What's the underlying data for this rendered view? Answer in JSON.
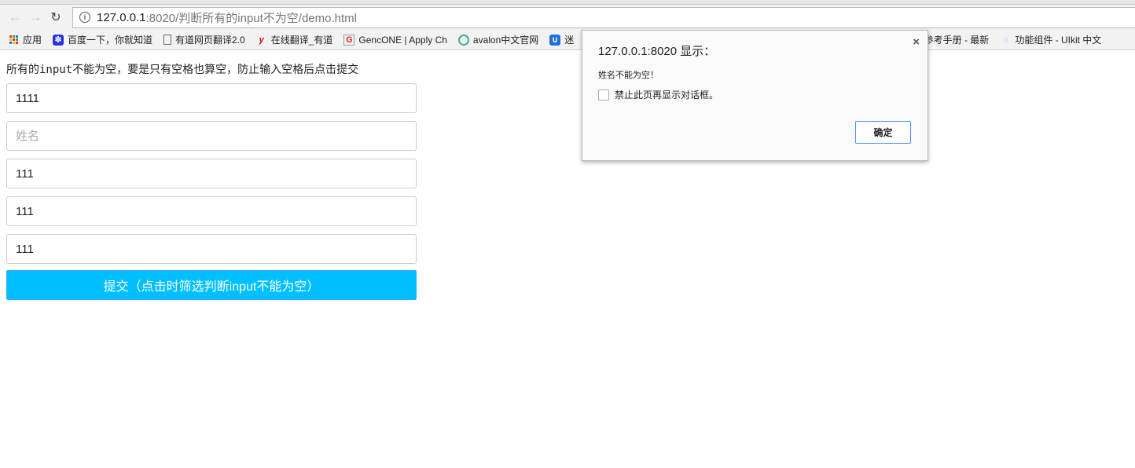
{
  "browser": {
    "url_host": "127.0.0.1",
    "url_path": ":8020/判断所有的input不为空/demo.html"
  },
  "bookmarks": [
    {
      "label": "应用",
      "icon": "apps-grid-icon"
    },
    {
      "label": "百度一下，你就知道",
      "icon": "baidu-paw-icon",
      "color": "#2932e1"
    },
    {
      "label": "有道网页翻译2.0",
      "icon": "page-icon"
    },
    {
      "label": "在线翻译_有道",
      "icon": "youdao-y-icon",
      "color": "#e60012"
    },
    {
      "label": "GencONE | Apply Ch",
      "icon": "g-logo-icon",
      "color": "#d22"
    },
    {
      "label": "avalon中文官网",
      "icon": "avalon-icon",
      "color": "#4a9"
    },
    {
      "label": "迷",
      "icon": "blue-logo-icon",
      "color": "#1e6fd9"
    },
    {
      "label": "CSS3参考手册 - 最新",
      "icon": ""
    },
    {
      "label": "功能组件 - UIkit 中文",
      "icon": "uikit-icon",
      "color": "#39f"
    }
  ],
  "page": {
    "heading": "所有的input不能为空，要是只有空格也算空，防止输入空格后点击提交",
    "inputs": [
      {
        "value": "1111",
        "placeholder": ""
      },
      {
        "value": "",
        "placeholder": "姓名"
      },
      {
        "value": "111",
        "placeholder": ""
      },
      {
        "value": "111",
        "placeholder": ""
      },
      {
        "value": "111",
        "placeholder": ""
      }
    ],
    "submit_label": "提交（点击时筛选判断input不能为空）",
    "accent": "#00bfff"
  },
  "dialog": {
    "title": "127.0.0.1:8020 显示：",
    "message": "姓名不能为空！",
    "checkbox_label": "禁止此页再显示对话框。",
    "ok_label": "确定",
    "close": "×"
  }
}
